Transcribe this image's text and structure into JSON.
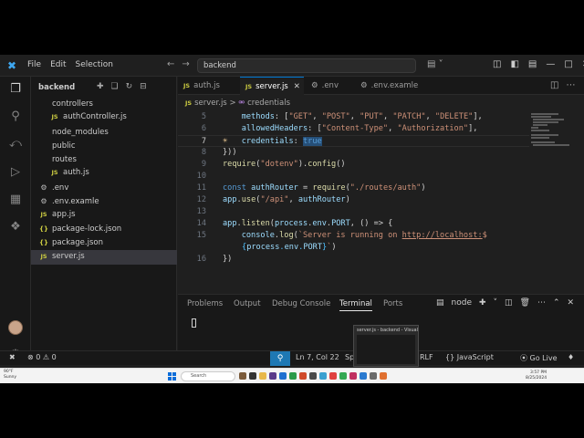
{
  "menu": [
    "File",
    "Edit",
    "Selection"
  ],
  "command_center": "backend",
  "sidebar": {
    "title": "backend",
    "items": [
      {
        "label": "controllers",
        "indent": 1,
        "icon": "chevron-down"
      },
      {
        "label": "authController.js",
        "indent": 2,
        "icon": "JS"
      },
      {
        "label": "node_modules",
        "indent": 1,
        "icon": "chevron-right"
      },
      {
        "label": "public",
        "indent": 1,
        "icon": "chevron-right"
      },
      {
        "label": "routes",
        "indent": 1,
        "icon": "chevron-down"
      },
      {
        "label": "auth.js",
        "indent": 2,
        "icon": "JS"
      },
      {
        "label": ".env",
        "indent": 1,
        "icon": "gear"
      },
      {
        "label": ".env.examle",
        "indent": 1,
        "icon": "gear"
      },
      {
        "label": "app.js",
        "indent": 1,
        "icon": "JS"
      },
      {
        "label": "package-lock.json",
        "indent": 1,
        "icon": "json"
      },
      {
        "label": "package.json",
        "indent": 1,
        "icon": "json"
      },
      {
        "label": "server.js",
        "indent": 1,
        "icon": "JS",
        "selected": true
      }
    ]
  },
  "tabs": [
    {
      "label": "auth.js",
      "icon": "JS"
    },
    {
      "label": "server.js",
      "icon": "JS",
      "active": true
    },
    {
      "label": ".env",
      "icon": "gear"
    },
    {
      "label": ".env.examle",
      "icon": "gear"
    }
  ],
  "breadcrumb": {
    "file": "server.js",
    "sep": ">",
    "symbol": "credentials"
  },
  "code_lines": [
    {
      "n": "5",
      "text": "    methods: [\"GET\", \"POST\", \"PUT\", \"PATCH\", \"DELETE\"],"
    },
    {
      "n": "6",
      "text": "    allowedHeaders: [\"Content-Type\", \"Authorization\"],"
    },
    {
      "n": "7",
      "text": "    credentials: true"
    },
    {
      "n": "8",
      "text": "}))"
    },
    {
      "n": "9",
      "text": "require(\"dotenv\").config()"
    },
    {
      "n": "10",
      "text": ""
    },
    {
      "n": "11",
      "text": "const authRouter = require(\"./routes/auth\")"
    },
    {
      "n": "12",
      "text": "app.use(\"/api\", authRouter)"
    },
    {
      "n": "13",
      "text": ""
    },
    {
      "n": "14",
      "text": "app.listen(process.env.PORT, () => {"
    },
    {
      "n": "15",
      "text": "    console.log(`Server is running on http://localhost:${process.env.PORT}`)"
    },
    {
      "n": "16",
      "text": "})"
    }
  ],
  "panel": {
    "tabs": [
      "Problems",
      "Output",
      "Debug Console",
      "Terminal",
      "Ports"
    ],
    "active": "Terminal",
    "shell": "node"
  },
  "status": {
    "errors": "0",
    "warnings": "0",
    "position": "Ln 7, Col 22",
    "spaces": "Sp",
    "eol": "RLF",
    "language": "JavaScript",
    "golive": "Go Live"
  },
  "preview_title": "server.js - backend - Visual",
  "taskbar": {
    "weather_temp": "90°F",
    "weather_desc": "Sunny",
    "search": "Search",
    "time": "3:57 PM",
    "date": "8/25/2024"
  },
  "colors": {
    "accent": "#0078d4",
    "keyword": "#569cd6",
    "string": "#ce9178",
    "js_icon": "#cbcb41"
  }
}
